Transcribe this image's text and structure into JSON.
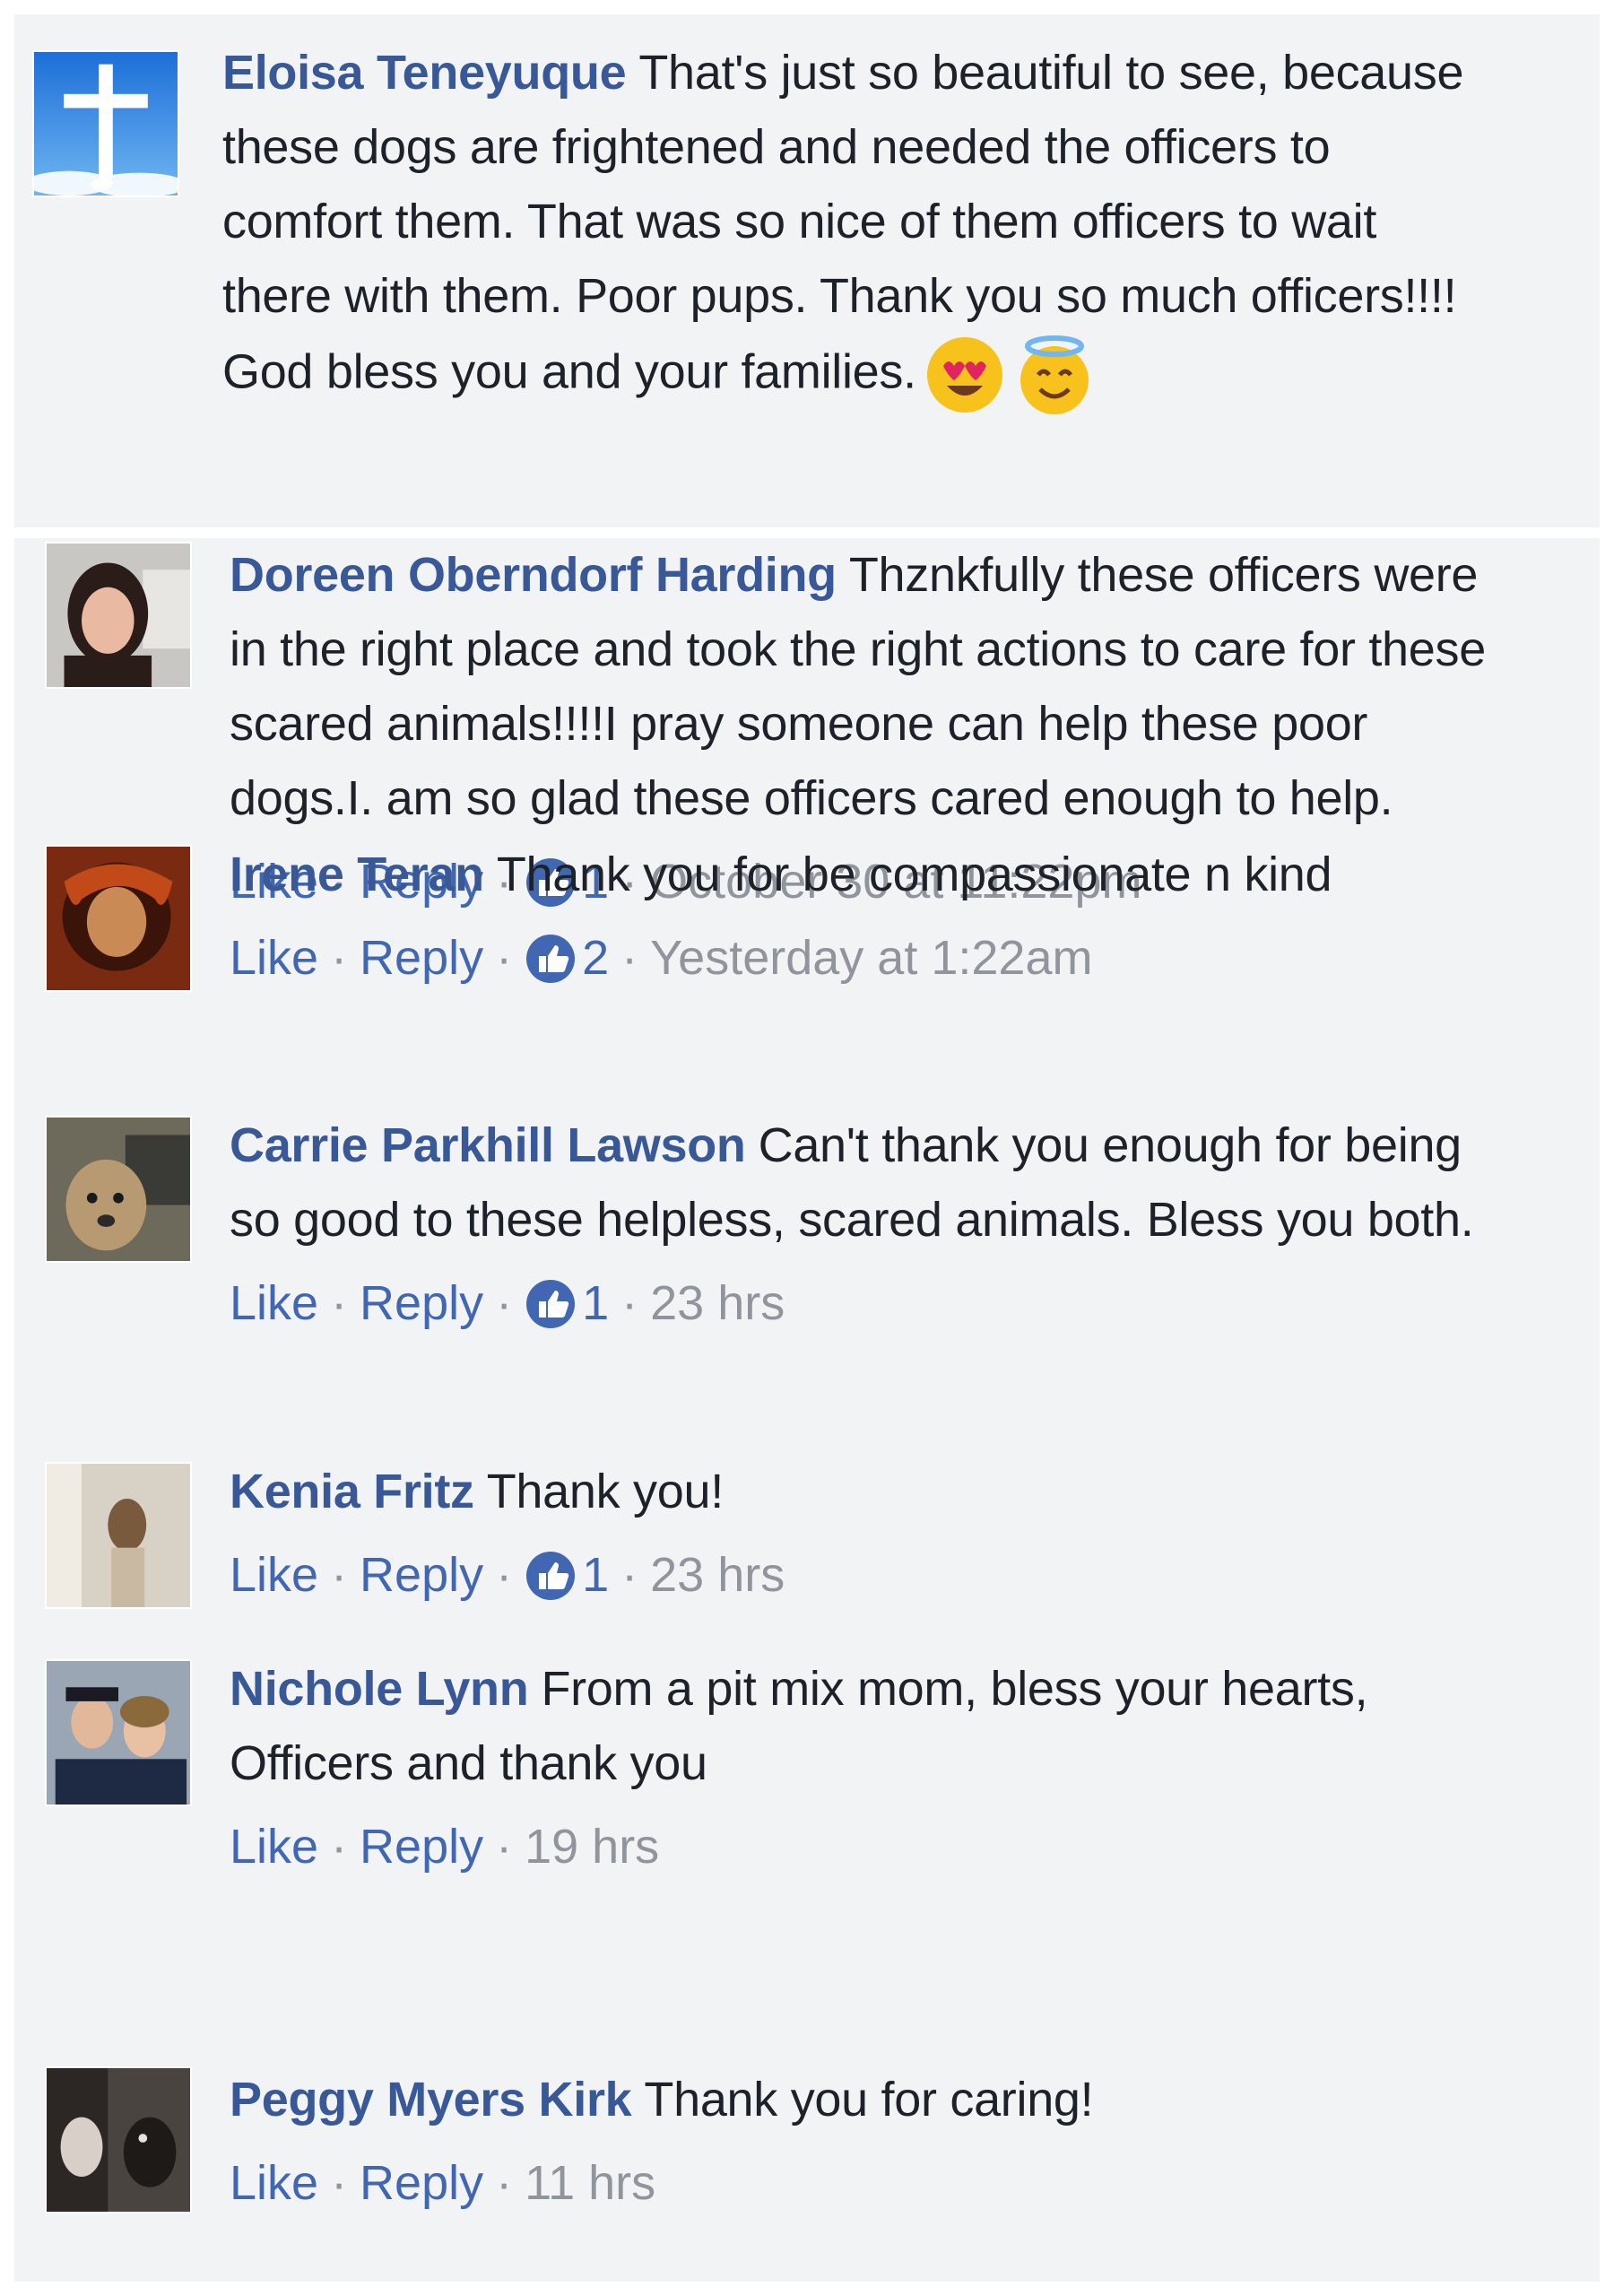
{
  "comments": [
    {
      "author": "Eloisa Teneyuque",
      "text": "That's just so beautiful to see, because these dogs are frightened and needed the officers to comfort them. That was so nice of them officers to wait there with them. Poor pups. Thank you so much officers!!!! God bless you and your families.",
      "emojis": [
        "heart-eyes-emoji",
        "smiling-face-with-halo-emoji"
      ],
      "avatar": "cross-icon"
    },
    {
      "author": "Doreen Oberndorf Harding",
      "text": "Thznkfully these officers were in the right place and took the right actions to care for these scared animals!!!!I pray someone can help these poor dogs.I. am so glad these officers cared enough to help.",
      "like_label": "Like",
      "reply_label": "Reply",
      "reactions": "1",
      "time": "October 30 at 11:22pm"
    },
    {
      "author": "Irene Teran",
      "text": "Thank you for be compassionate n kind",
      "like_label": "Like",
      "reply_label": "Reply",
      "reactions": "2",
      "time": "Yesterday at 1:22am"
    },
    {
      "author": "Carrie Parkhill Lawson",
      "text": "Can't thank you enough for being so good to these helpless, scared animals. Bless you both.",
      "like_label": "Like",
      "reply_label": "Reply",
      "reactions": "1",
      "time": "23 hrs"
    },
    {
      "author": "Kenia Fritz",
      "text": "Thank you!",
      "like_label": "Like",
      "reply_label": "Reply",
      "reactions": "1",
      "time": "23 hrs"
    },
    {
      "author": "Nichole Lynn",
      "text": "From a pit mix mom, bless your hearts, Officers and thank you",
      "like_label": "Like",
      "reply_label": "Reply",
      "time": "19 hrs"
    },
    {
      "author": "Peggy Myers Kirk",
      "text": "Thank you for caring!",
      "like_label": "Like",
      "reply_label": "Reply",
      "time": "11 hrs"
    }
  ],
  "colors": {
    "author": "#385898",
    "link": "#4267b2",
    "meta": "#90949c",
    "text": "#1d2129",
    "panel": "#f2f3f5"
  }
}
